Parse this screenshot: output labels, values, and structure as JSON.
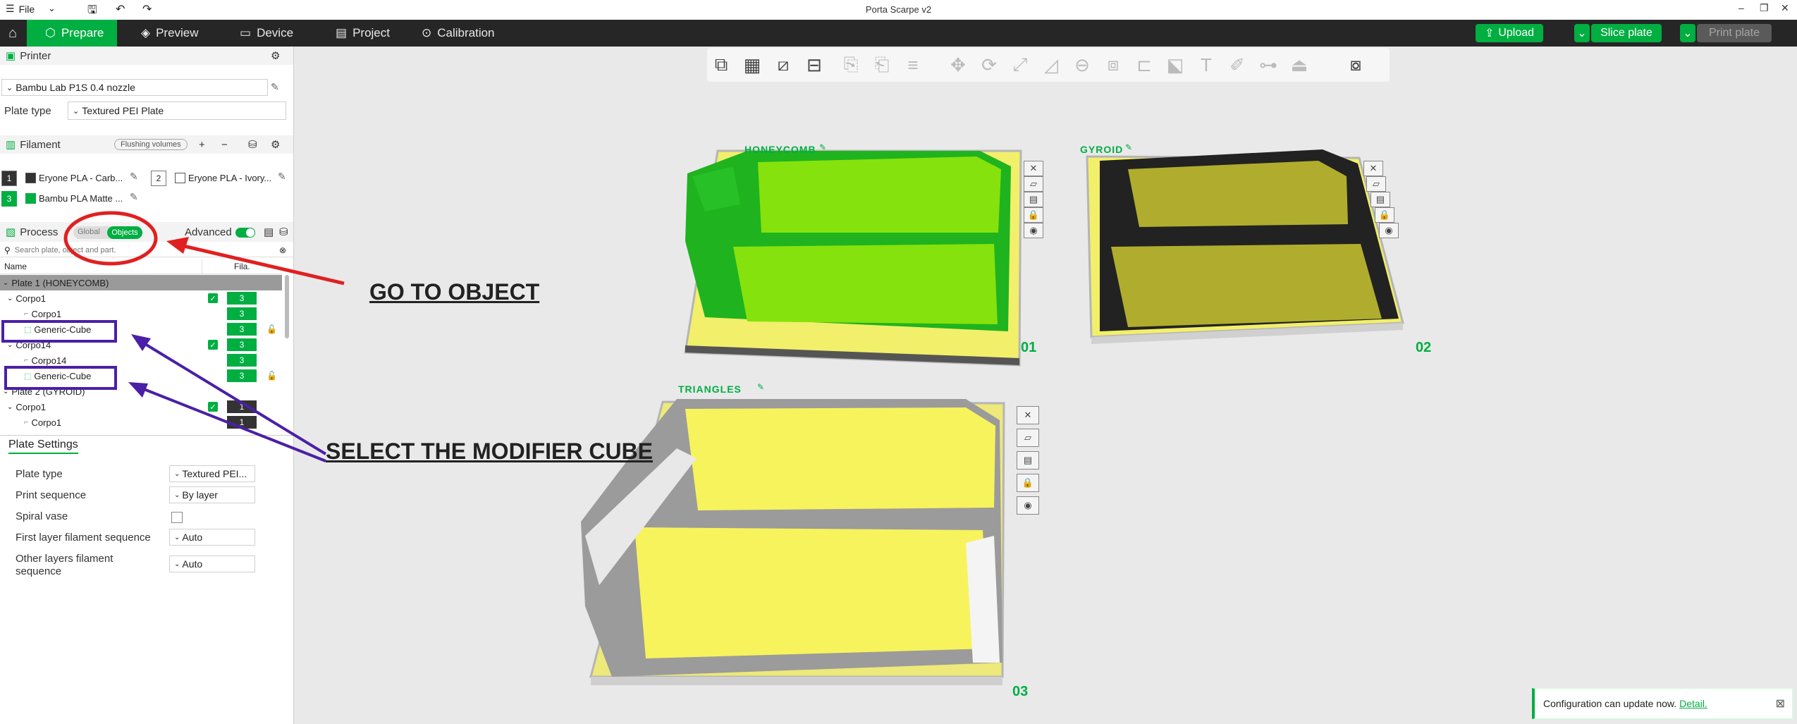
{
  "window": {
    "title": "Porta Scarpe v2",
    "menu_label": "File"
  },
  "tabs": [
    {
      "label": "Prepare"
    },
    {
      "label": "Preview"
    },
    {
      "label": "Device"
    },
    {
      "label": "Project"
    },
    {
      "label": "Calibration"
    }
  ],
  "actions": {
    "upload": "Upload",
    "slice": "Slice plate",
    "print": "Print plate"
  },
  "printer": {
    "section_label": "Printer",
    "printer_name": "Bambu Lab P1S 0.4 nozzle",
    "plate_type_label": "Plate type",
    "plate_type_value": "Textured PEI Plate"
  },
  "filament": {
    "section_label": "Filament",
    "flushing_label": "Flushing volumes",
    "items": [
      {
        "index": "1",
        "name": "Eryone PLA - Carb...",
        "color": "#333333"
      },
      {
        "index": "2",
        "name": "Eryone PLA - Ivory...",
        "color": "#ffffff"
      },
      {
        "index": "3",
        "name": "Bambu PLA Matte ...",
        "color": "#00ae42"
      }
    ]
  },
  "process": {
    "section_label": "Process",
    "global_label": "Global",
    "objects_label": "Objects",
    "advanced_label": "Advanced",
    "search_placeholder": "Search plate, object and part."
  },
  "object_list": {
    "col_name": "Name",
    "col_fila": "Fila.",
    "rows": [
      {
        "name": "Plate 1 (HONEYCOMB)",
        "kind": "plate"
      },
      {
        "name": "Corpo1",
        "fila": "3",
        "checked": true
      },
      {
        "name": "Corpo1",
        "fila": "3"
      },
      {
        "name": "Generic-Cube",
        "fila": "3",
        "locked": true
      },
      {
        "name": "Corpo14",
        "fila": "3",
        "checked": true
      },
      {
        "name": "Corpo14",
        "fila": "3"
      },
      {
        "name": "Generic-Cube",
        "fila": "3",
        "locked": true
      },
      {
        "name": "Plate 2 (GYROID)",
        "kind": "plate"
      },
      {
        "name": "Corpo1",
        "fila": "1",
        "checked": true
      },
      {
        "name": "Corpo1",
        "fila": "1"
      }
    ]
  },
  "plate_settings": {
    "title": "Plate Settings",
    "plate_type_label": "Plate type",
    "plate_type_value": "Textured PEI...",
    "print_sequence_label": "Print sequence",
    "print_sequence_value": "By layer",
    "spiral_vase_label": "Spiral vase",
    "first_layer_label": "First layer filament sequence",
    "first_layer_value": "Auto",
    "other_layers_label": "Other layers filament sequence",
    "other_layers_value": "Auto"
  },
  "plates": [
    {
      "name": "HONEYCOMB",
      "number": "01"
    },
    {
      "name": "GYROID",
      "number": "02"
    },
    {
      "name": "TRIANGLES",
      "number": "03"
    }
  ],
  "annotations": {
    "go_to_object": "GO TO OBJECT",
    "select_modifier": "SELECT THE MODIFIER CUBE"
  },
  "notification": {
    "text": "Configuration can update now.",
    "link": "Detail."
  },
  "colors": {
    "accent": "#00ae42",
    "annotation_red": "#e02020",
    "annotation_purple": "#4b1fa6"
  }
}
